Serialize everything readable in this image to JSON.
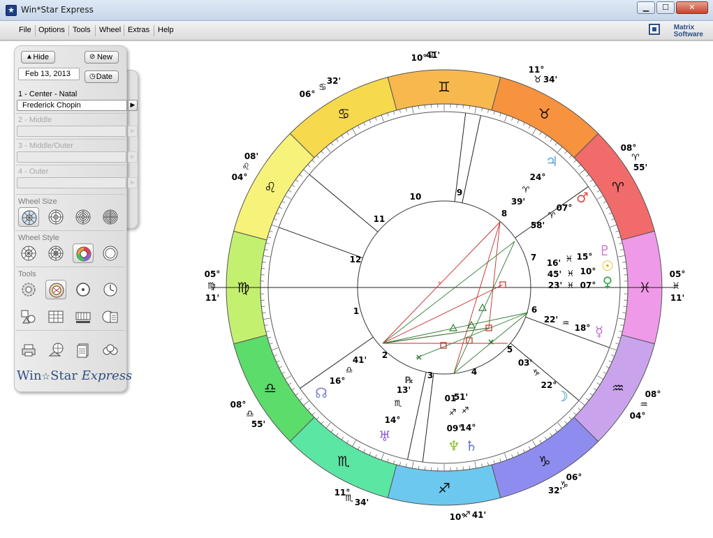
{
  "window": {
    "title": "Win*Star Express",
    "minimize": "▁",
    "maximize": "☐",
    "close": "✕"
  },
  "menu": {
    "items": [
      "File",
      "Options",
      "Tools",
      "Wheel",
      "Extras",
      "Help"
    ],
    "brand_line1": "Matrix",
    "brand_line2": "Software"
  },
  "panel": {
    "hide_label": "Hide",
    "new_label": "New",
    "date_value": "Feb 13, 2013",
    "date_label": "Date",
    "slot1_label": "1 - Center - Natal",
    "slot1_value": "Frederick Chopin",
    "slot2_label": "2 - Middle",
    "slot3_label": "3 - Middle/Outer",
    "slot4_label": "4 - Outer",
    "wheel_size_title": "Wheel Size",
    "wheel_style_title": "Wheel Style",
    "tools_title": "Tools",
    "logo_text": "Win",
    "logo_star": "☆",
    "logo_star_word": "Star",
    "logo_express": "Express"
  },
  "colors": {
    "accent_blue": "#2f4f80",
    "chart_red": "#c62828",
    "chart_green": "#2e7d32"
  },
  "chart": {
    "outer_cusp_degrees": [
      {
        "deg": "10°",
        "sign": "♊",
        "min": "41'"
      },
      {
        "deg": "11°",
        "sign": "♉",
        "min": "34'"
      },
      {
        "deg": "08°",
        "sign": "♈",
        "min": "55'"
      },
      {
        "deg": "05°",
        "sign": "♓",
        "min": "11'"
      },
      {
        "deg": "08°",
        "sign": "♒",
        "min": "04°"
      },
      {
        "deg": "06°",
        "sign": "♑",
        "min": "32'"
      },
      {
        "deg": "10°",
        "sign": "♐",
        "min": "41'"
      },
      {
        "deg": "11°",
        "sign": "♏",
        "min": "34'"
      },
      {
        "deg": "08°",
        "sign": "♎",
        "min": "55'"
      },
      {
        "deg": "05°",
        "sign": "♍",
        "min": "11'"
      },
      {
        "deg": "08'",
        "sign": "♌",
        "min": "04°"
      },
      {
        "deg": "06°",
        "sign": "♋",
        "min": "32'"
      }
    ],
    "house_numbers": [
      "1",
      "2",
      "3",
      "4",
      "5",
      "6",
      "7",
      "8",
      "9",
      "10",
      "11",
      "12"
    ],
    "sign_glyphs": [
      "♊",
      "♉",
      "♈",
      "♓",
      "♒",
      "♑",
      "♐",
      "♏",
      "♎",
      "♍",
      "♌",
      "♋"
    ],
    "planets": [
      {
        "glyph": "♃",
        "deg": "24°",
        "sign": "♈",
        "min": "39'",
        "color": "#5aa7e0"
      },
      {
        "glyph": "♂",
        "deg": "07°",
        "sign": "♈",
        "min": "58'",
        "color": "#e05050"
      },
      {
        "glyph": "♇",
        "deg": "15°",
        "sign": "♓",
        "min": "16'",
        "color": "#d070d8"
      },
      {
        "glyph": "☉",
        "deg": "10°",
        "sign": "♓",
        "min": "45'",
        "color": "#d4b400"
      },
      {
        "glyph": "♀",
        "deg": "07°",
        "sign": "♓",
        "min": "23'",
        "color": "#2ea84a"
      },
      {
        "glyph": "☿",
        "deg": "18°",
        "sign": "♒",
        "min": "22'",
        "color": "#c070d0"
      },
      {
        "glyph": "☽",
        "deg": "22°",
        "sign": "♑",
        "min": "03'",
        "color": "#1f8fb0"
      },
      {
        "glyph": "♄",
        "deg": "14°",
        "sign": "♐",
        "min": "51'",
        "color": "#6070d0"
      },
      {
        "glyph": "♆",
        "deg": "09°",
        "sign": "♐",
        "min": "01",
        "color": "#8cc030"
      },
      {
        "glyph": "♅",
        "deg": "14°",
        "sign": "♏",
        "min": "13'",
        "color": "#9060d0"
      },
      {
        "glyph": "☊",
        "deg": "16°",
        "sign": "♎",
        "min": "41'",
        "color": "#8080d0"
      }
    ],
    "retrograde": "℞",
    "part_of_fortune": "⊗"
  }
}
